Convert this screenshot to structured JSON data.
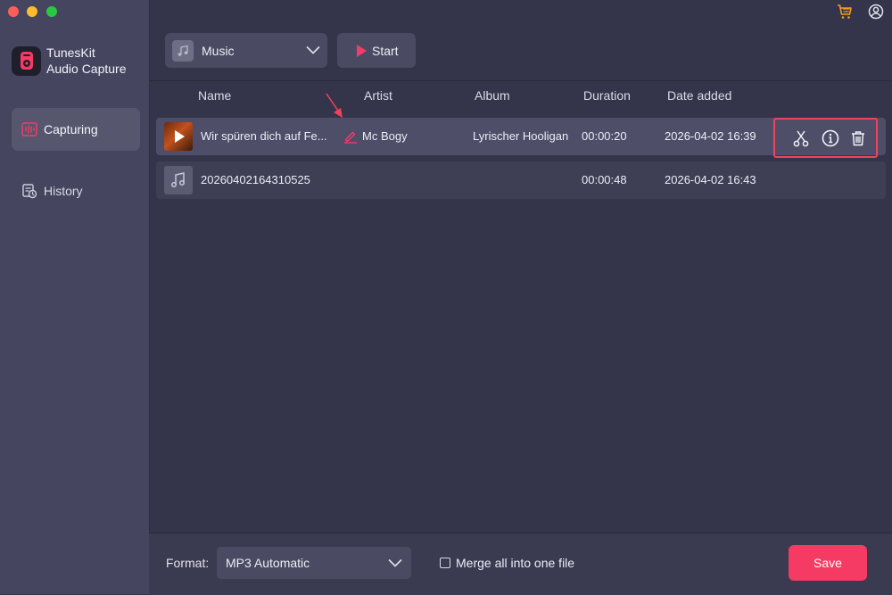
{
  "app": {
    "name_line1": "TunesKit",
    "name_line2": "Audio Capture"
  },
  "sidebar": {
    "items": [
      {
        "label": "Capturing",
        "icon": "capture-wave-icon",
        "active": true
      },
      {
        "label": "History",
        "icon": "history-icon",
        "active": false
      }
    ]
  },
  "toolbar": {
    "source": "Music",
    "start_label": "Start"
  },
  "table": {
    "columns": [
      "Name",
      "Artist",
      "Album",
      "Duration",
      "Date added"
    ],
    "rows": [
      {
        "name": "Wir spüren dich auf Fe...",
        "artist": "Mc Bogy",
        "album": "Lyrischer Hooligan",
        "duration": "00:00:20",
        "date_added": "2026-04-02 16:39",
        "selected": true
      },
      {
        "name": "20260402164310525",
        "artist": "",
        "album": "",
        "duration": "00:00:48",
        "date_added": "2026-04-02 16:43",
        "selected": false
      }
    ]
  },
  "row_actions": [
    "scissors-icon",
    "info-icon",
    "trash-icon"
  ],
  "footer": {
    "format_label": "Format:",
    "format_value": "MP3 Automatic",
    "merge_label": "Merge all into one file",
    "merge_checked": false,
    "save_label": "Save"
  },
  "colors": {
    "accent": "#f53b63",
    "highlight_border": "#f0425b",
    "sidebar_bg": "#454560",
    "main_bg": "#34344a"
  }
}
